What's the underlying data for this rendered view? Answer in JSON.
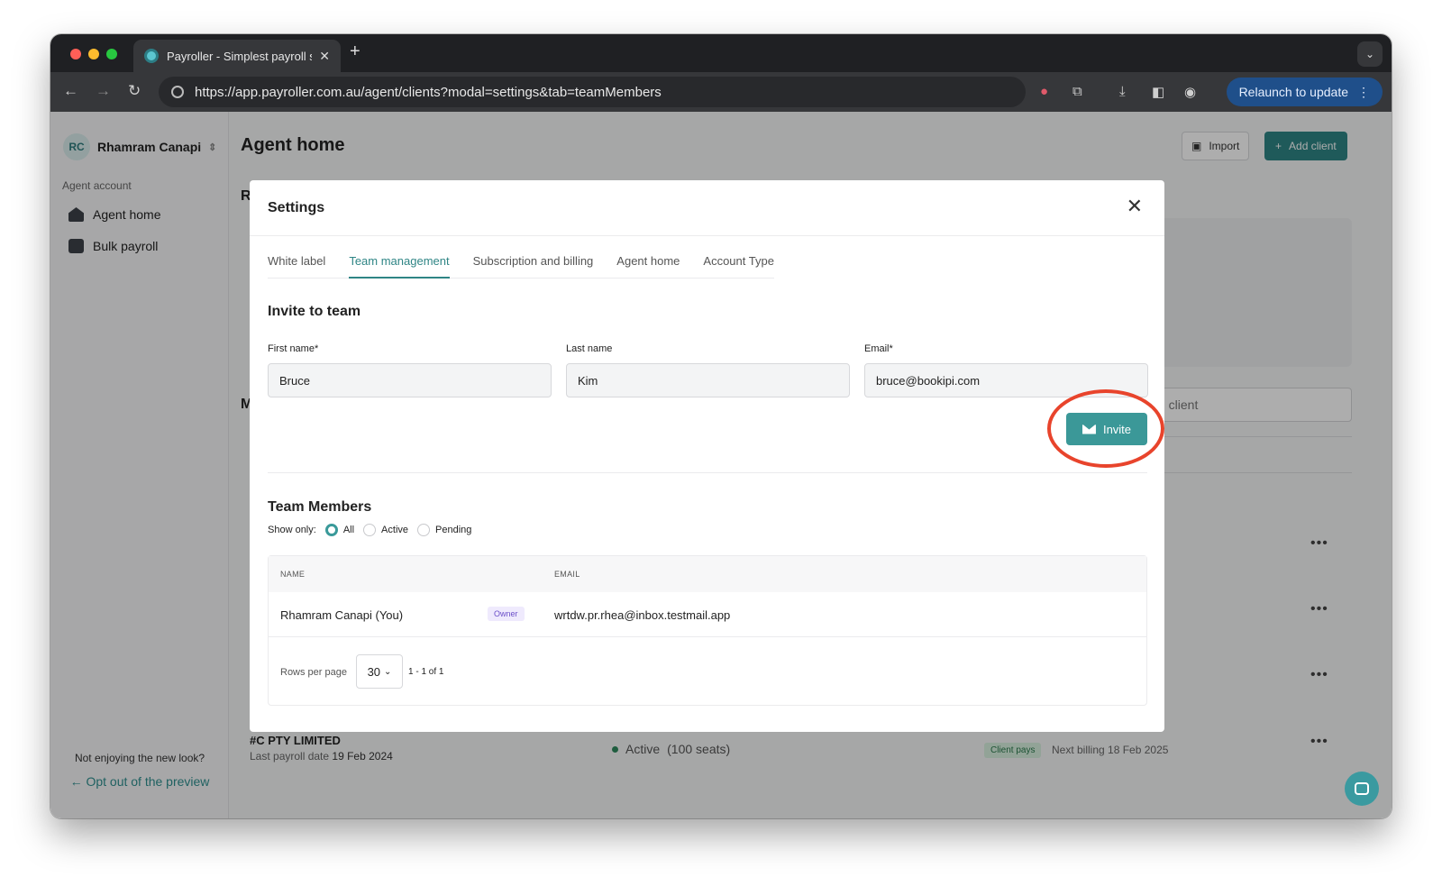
{
  "browser": {
    "tab_title": "Payroller - Simplest payroll sc",
    "url": "https://app.payroller.com.au/agent/clients?modal=settings&tab=teamMembers",
    "relaunch_label": "Relaunch to update"
  },
  "sidebar": {
    "avatar_initials": "RC",
    "org_name": "Rhamram Canapi",
    "section_label": "Agent account",
    "items": [
      {
        "label": "Agent home",
        "icon": "home-icon"
      },
      {
        "label": "Bulk payroll",
        "icon": "bulk-payroll-icon"
      }
    ],
    "footer_question": "Not enjoying the new look?",
    "opt_out_label": "Opt out of the preview"
  },
  "main": {
    "title": "Agent home",
    "import_label": "Import",
    "add_client_label": "Add client",
    "section_letter_1": "R",
    "section_letter_2": "M",
    "search_partial": "h client",
    "bottom_row": {
      "company": "#C PTY LIMITED",
      "last_payroll_label": "Last payroll date",
      "last_payroll_date": "19 Feb 2024",
      "status": "Active",
      "seats": "(100 seats)",
      "badge": "Client pays",
      "next_billing": "Next billing 18 Feb 2025"
    }
  },
  "modal": {
    "title": "Settings",
    "tabs": [
      {
        "label": "White label",
        "active": false
      },
      {
        "label": "Team management",
        "active": true
      },
      {
        "label": "Subscription and billing",
        "active": false
      },
      {
        "label": "Agent home",
        "active": false
      },
      {
        "label": "Account Type",
        "active": false
      }
    ],
    "invite": {
      "title": "Invite to team",
      "first_name_label": "First name*",
      "first_name_value": "Bruce",
      "last_name_label": "Last name",
      "last_name_value": "Kim",
      "email_label": "Email*",
      "email_value": "bruce@bookipi.com",
      "invite_button": "Invite"
    },
    "team": {
      "title": "Team Members",
      "show_only_label": "Show only:",
      "filters": [
        {
          "label": "All",
          "selected": true
        },
        {
          "label": "Active",
          "selected": false
        },
        {
          "label": "Pending",
          "selected": false
        }
      ],
      "columns": [
        "NAME",
        "EMAIL"
      ],
      "rows": [
        {
          "name": "Rhamram Canapi (You)",
          "role": "Owner",
          "email": "wrtdw.pr.rhea@inbox.testmail.app"
        }
      ],
      "rows_per_page_label": "Rows per page",
      "rows_per_page_value": "30",
      "range_label": "1 - 1 of 1"
    }
  },
  "colors": {
    "accent": "#2f8585",
    "highlight": "#e8442c"
  }
}
